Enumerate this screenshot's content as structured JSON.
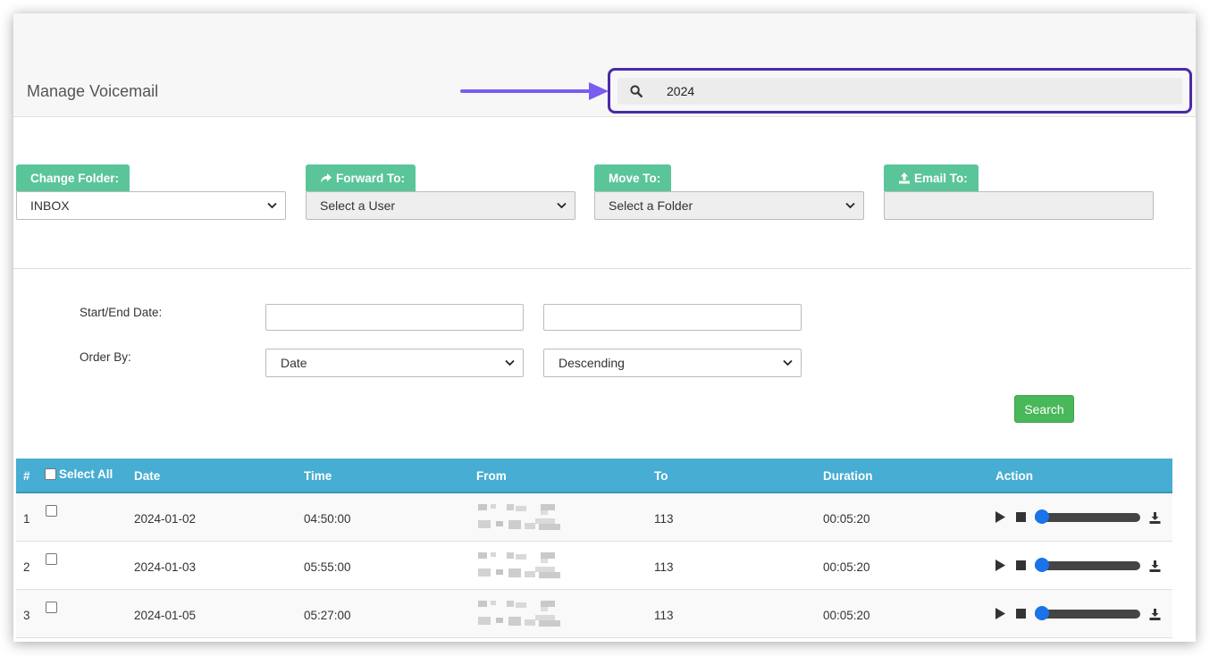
{
  "page_title": "Manage Voicemail",
  "search": {
    "value": "2024",
    "icon": "search-icon"
  },
  "actions": {
    "change_folder": {
      "label": "Change Folder:",
      "selected": "INBOX"
    },
    "forward_to": {
      "label": "Forward To:",
      "selected": "Select a User",
      "icon": "share-icon"
    },
    "move_to": {
      "label": "Move To:",
      "selected": "Select a Folder"
    },
    "email_to": {
      "label": "Email To:",
      "value": "",
      "icon": "upload-icon"
    }
  },
  "filters": {
    "date_label": "Start/End Date:",
    "start_date": "",
    "end_date": "",
    "order_label": "Order By:",
    "order_field": "Date",
    "order_direction": "Descending",
    "search_button": "Search"
  },
  "table": {
    "columns": {
      "num": "#",
      "select_all": "Select All",
      "date": "Date",
      "time": "Time",
      "from": "From",
      "to": "To",
      "duration": "Duration",
      "action": "Action"
    },
    "rows": [
      {
        "num": "1",
        "date": "2024-01-02",
        "time": "04:50:00",
        "to": "113",
        "duration": "00:05:20"
      },
      {
        "num": "2",
        "date": "2024-01-03",
        "time": "05:55:00",
        "to": "113",
        "duration": "00:05:20"
      },
      {
        "num": "3",
        "date": "2024-01-05",
        "time": "05:27:00",
        "to": "113",
        "duration": "00:05:20"
      }
    ]
  },
  "colors": {
    "header_blue": "#47add2",
    "label_green": "#5bc59a",
    "button_green": "#49b85a",
    "highlight_purple": "#4b2aa8",
    "arrow_purple": "#7b5cf0"
  }
}
